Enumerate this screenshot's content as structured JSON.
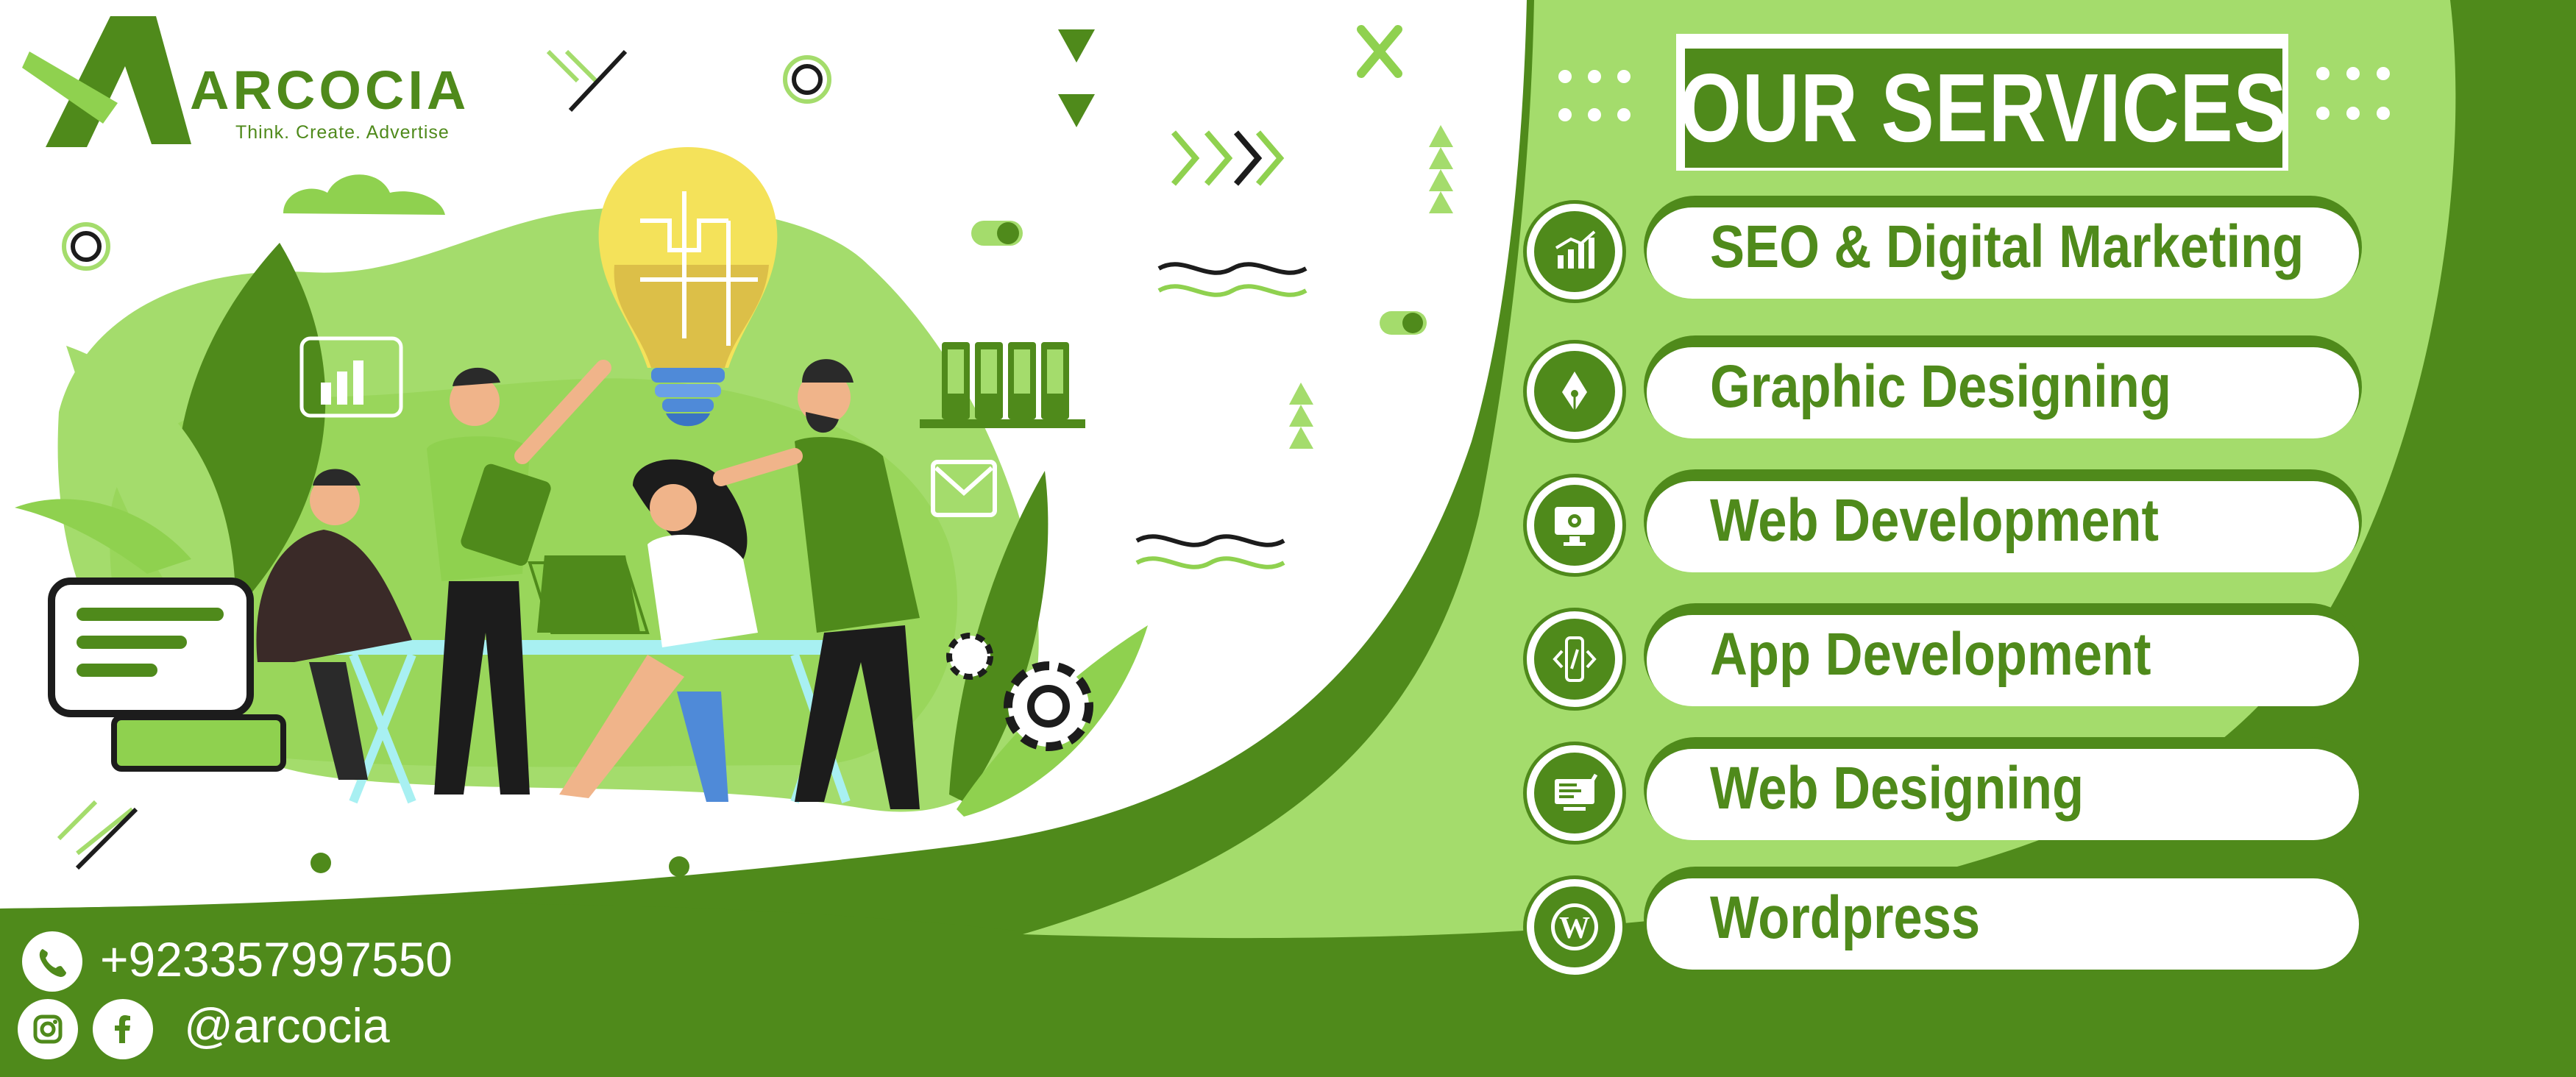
{
  "brand": {
    "name": "ARCOCIA",
    "tagline": "Think. Create. Advertise",
    "logo_icon": "stylized-letter-a-logo"
  },
  "services_section": {
    "title": "OUR SERVICES",
    "items": [
      {
        "label": "SEO & Digital Marketing",
        "icon": "growth-chart-icon"
      },
      {
        "label": "Graphic Designing",
        "icon": "pen-nib-icon"
      },
      {
        "label": "Web Development",
        "icon": "monitor-gear-icon"
      },
      {
        "label": "App Development",
        "icon": "mobile-code-icon"
      },
      {
        "label": "Web Designing",
        "icon": "monitor-design-icon"
      },
      {
        "label": "Wordpress",
        "icon": "wordpress-icon"
      }
    ]
  },
  "contact": {
    "phone": "+923357997550",
    "social_handle": "@arcocia",
    "icons": [
      "phone-icon",
      "instagram-icon",
      "facebook-icon"
    ]
  },
  "colors": {
    "brand_dark_green": "#4f8a1b",
    "light_green": "#a4dc6c",
    "lime": "#8fd14f",
    "white": "#ffffff"
  },
  "illustration": {
    "description_icons": [
      "lightbulb-puzzle-icon",
      "team-at-desk-illustration",
      "gear-icon",
      "bar-chart-icon",
      "envelope-icon",
      "book-shelf-icon"
    ]
  }
}
